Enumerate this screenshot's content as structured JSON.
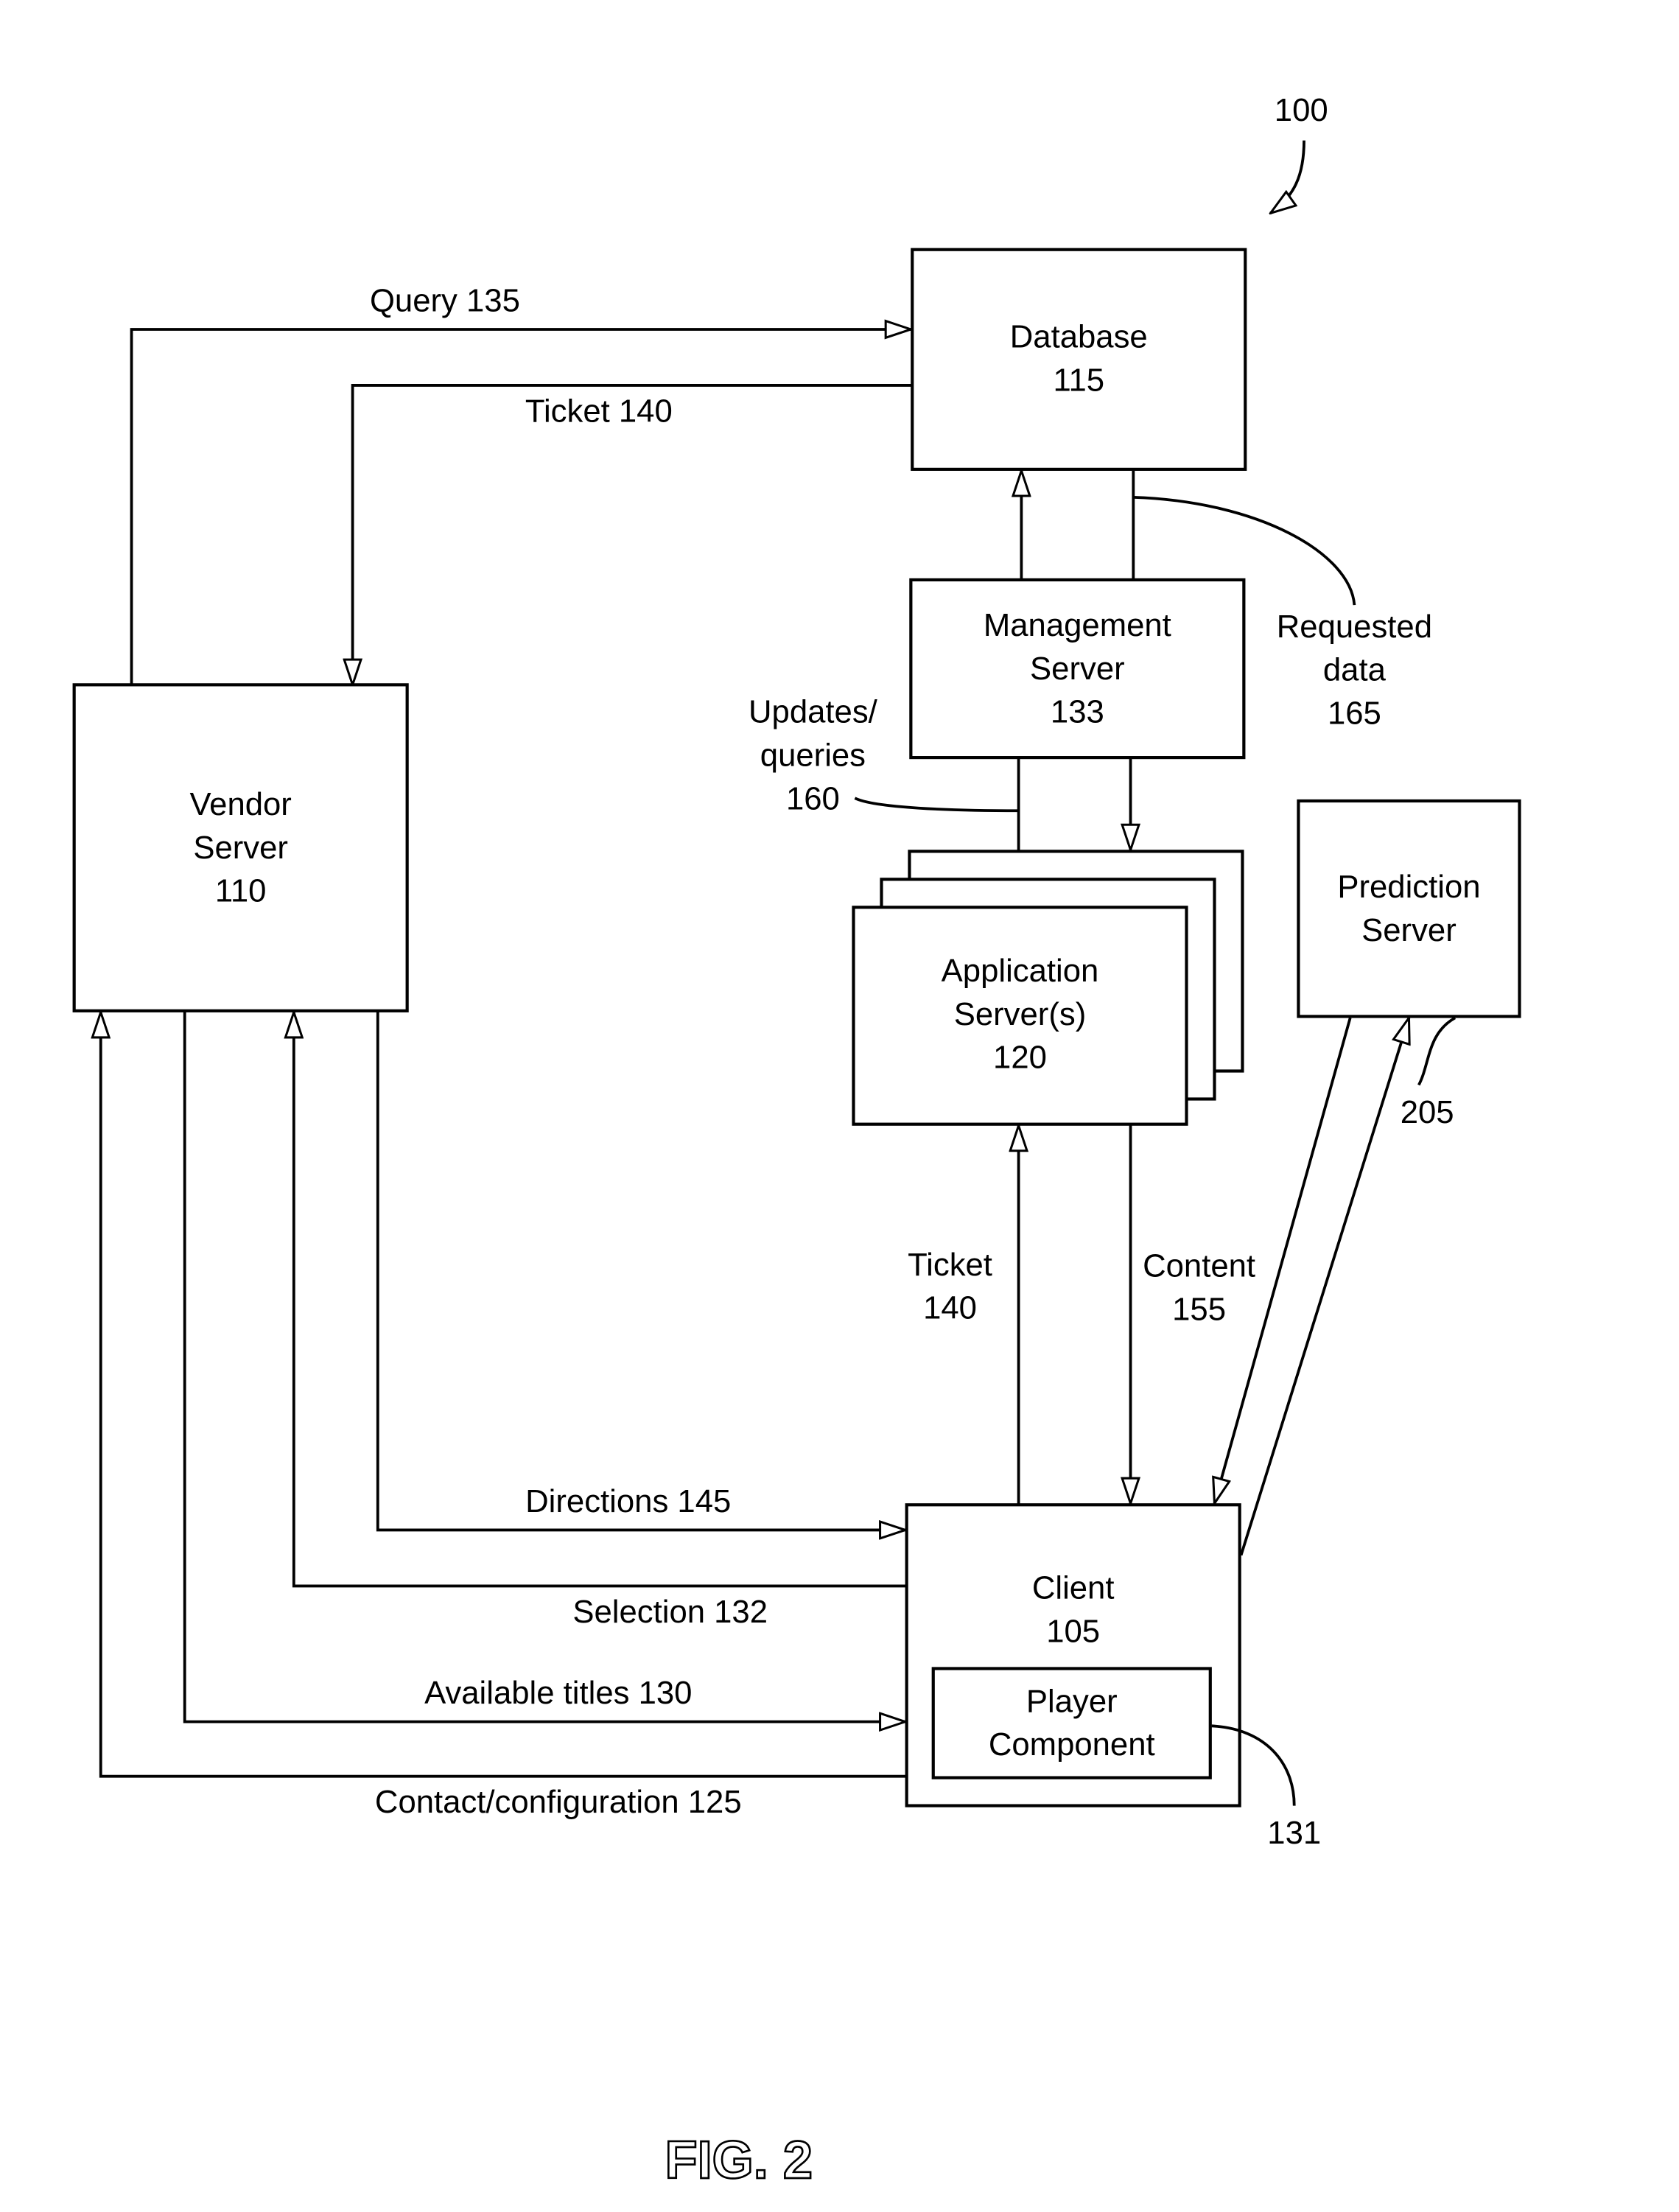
{
  "figure": {
    "label": "FIG. 2",
    "ref_system": "100"
  },
  "nodes": {
    "database": {
      "line1": "Database",
      "line2": "115"
    },
    "management": {
      "line1": "Management",
      "line2": "Server",
      "line3": "133"
    },
    "vendor": {
      "line1": "Vendor",
      "line2": "Server",
      "line3": "110"
    },
    "application": {
      "line1": "Application",
      "line2": "Server(s)",
      "line3": "120"
    },
    "prediction": {
      "line1": "Prediction",
      "line2": "Server"
    },
    "client": {
      "line1": "Client",
      "line2": "105"
    },
    "player": {
      "line1": "Player",
      "line2": "Component"
    }
  },
  "edges": {
    "query": "Query 135",
    "ticket_top": "Ticket 140",
    "requested_data": {
      "line1": "Requested",
      "line2": "data",
      "line3": "165"
    },
    "updates": {
      "line1": "Updates/",
      "line2": "queries",
      "line3": "160"
    },
    "ticket_mid": {
      "line1": "Ticket",
      "line2": "140"
    },
    "content": {
      "line1": "Content",
      "line2": "155"
    },
    "directions": "Directions 145",
    "selection": "Selection 132",
    "available": "Available titles 130",
    "contact": "Contact/configuration 125"
  },
  "refs": {
    "prediction_link": "205",
    "player_ref": "131"
  }
}
